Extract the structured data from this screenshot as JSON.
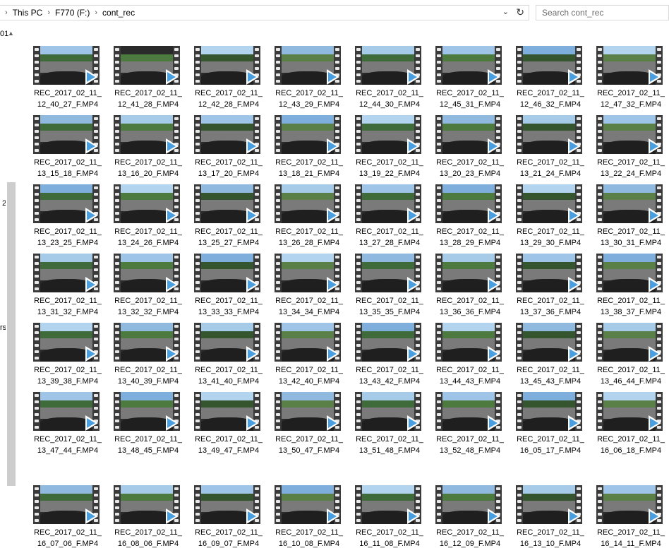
{
  "address": {
    "crumbs": [
      "This PC",
      "F770 (F:)",
      "cont_rec"
    ],
    "separator": "›",
    "dropdown_glyph": "⌄",
    "refresh_glyph": "↻"
  },
  "search": {
    "placeholder": "Search cont_rec"
  },
  "nav_fragments": [
    "01",
    "2",
    "rsl"
  ],
  "icons": {
    "play": "play-icon",
    "video": "video-file-icon"
  },
  "files": [
    [
      "REC_2017_02_11_",
      "12_40_27_F.MP4"
    ],
    [
      "REC_2017_02_11_",
      "12_41_28_F.MP4"
    ],
    [
      "REC_2017_02_11_",
      "12_42_28_F.MP4"
    ],
    [
      "REC_2017_02_11_",
      "12_43_29_F.MP4"
    ],
    [
      "REC_2017_02_11_",
      "12_44_30_F.MP4"
    ],
    [
      "REC_2017_02_11_",
      "12_45_31_F.MP4"
    ],
    [
      "REC_2017_02_11_",
      "12_46_32_F.MP4"
    ],
    [
      "REC_2017_02_11_",
      "12_47_32_F.MP4"
    ],
    [
      "REC_2017_02_11_",
      "13_15_18_F.MP4"
    ],
    [
      "REC_2017_02_11_",
      "13_16_20_F.MP4"
    ],
    [
      "REC_2017_02_11_",
      "13_17_20_F.MP4"
    ],
    [
      "REC_2017_02_11_",
      "13_18_21_F.MP4"
    ],
    [
      "REC_2017_02_11_",
      "13_19_22_F.MP4"
    ],
    [
      "REC_2017_02_11_",
      "13_20_23_F.MP4"
    ],
    [
      "REC_2017_02_11_",
      "13_21_24_F.MP4"
    ],
    [
      "REC_2017_02_11_",
      "13_22_24_F.MP4"
    ],
    [
      "REC_2017_02_11_",
      "13_23_25_F.MP4"
    ],
    [
      "REC_2017_02_11_",
      "13_24_26_F.MP4"
    ],
    [
      "REC_2017_02_11_",
      "13_25_27_F.MP4"
    ],
    [
      "REC_2017_02_11_",
      "13_26_28_F.MP4"
    ],
    [
      "REC_2017_02_11_",
      "13_27_28_F.MP4"
    ],
    [
      "REC_2017_02_11_",
      "13_28_29_F.MP4"
    ],
    [
      "REC_2017_02_11_",
      "13_29_30_F.MP4"
    ],
    [
      "REC_2017_02_11_",
      "13_30_31_F.MP4"
    ],
    [
      "REC_2017_02_11_",
      "13_31_32_F.MP4"
    ],
    [
      "REC_2017_02_11_",
      "13_32_32_F.MP4"
    ],
    [
      "REC_2017_02_11_",
      "13_33_33_F.MP4"
    ],
    [
      "REC_2017_02_11_",
      "13_34_34_F.MP4"
    ],
    [
      "REC_2017_02_11_",
      "13_35_35_F.MP4"
    ],
    [
      "REC_2017_02_11_",
      "13_36_36_F.MP4"
    ],
    [
      "REC_2017_02_11_",
      "13_37_36_F.MP4"
    ],
    [
      "REC_2017_02_11_",
      "13_38_37_F.MP4"
    ],
    [
      "REC_2017_02_11_",
      "13_39_38_F.MP4"
    ],
    [
      "REC_2017_02_11_",
      "13_40_39_F.MP4"
    ],
    [
      "REC_2017_02_11_",
      "13_41_40_F.MP4"
    ],
    [
      "REC_2017_02_11_",
      "13_42_40_F.MP4"
    ],
    [
      "REC_2017_02_11_",
      "13_43_42_F.MP4"
    ],
    [
      "REC_2017_02_11_",
      "13_44_43_F.MP4"
    ],
    [
      "REC_2017_02_11_",
      "13_45_43_F.MP4"
    ],
    [
      "REC_2017_02_11_",
      "13_46_44_F.MP4"
    ],
    [
      "REC_2017_02_11_",
      "13_47_44_F.MP4"
    ],
    [
      "REC_2017_02_11_",
      "13_48_45_F.MP4"
    ],
    [
      "REC_2017_02_11_",
      "13_49_47_F.MP4"
    ],
    [
      "REC_2017_02_11_",
      "13_50_47_F.MP4"
    ],
    [
      "REC_2017_02_11_",
      "13_51_48_F.MP4"
    ],
    [
      "REC_2017_02_11_",
      "13_52_48_F.MP4"
    ],
    [
      "REC_2017_02_11_",
      "16_05_17_F.MP4"
    ],
    [
      "REC_2017_02_11_",
      "16_06_18_F.MP4"
    ],
    [
      "REC_2017_02_11_",
      "16_07_06_F.MP4"
    ],
    [
      "REC_2017_02_11_",
      "16_08_06_F.MP4"
    ],
    [
      "REC_2017_02_11_",
      "16_09_07_F.MP4"
    ],
    [
      "REC_2017_02_11_",
      "16_10_08_F.MP4"
    ],
    [
      "REC_2017_02_11_",
      "16_11_08_F.MP4"
    ],
    [
      "REC_2017_02_11_",
      "16_12_09_F.MP4"
    ],
    [
      "REC_2017_02_11_",
      "16_13_10_F.MP4"
    ],
    [
      "REC_2017_02_11_",
      "16_14_11_F.MP4"
    ]
  ],
  "colors": {
    "play_accent": "#4a9fe0",
    "film_strip": "#3a3a3a",
    "sky": "#8fb9df",
    "trees": "#3f6b3a"
  }
}
